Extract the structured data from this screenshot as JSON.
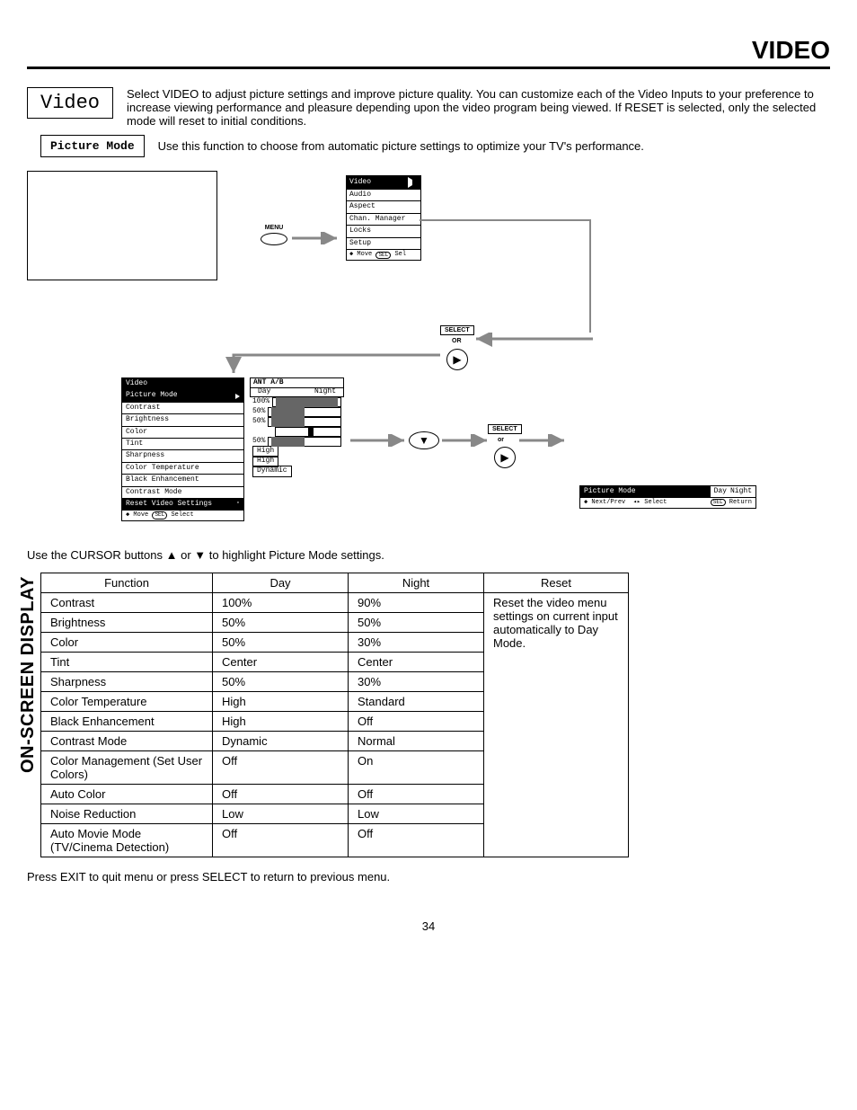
{
  "header": {
    "title": "VIDEO"
  },
  "intro": {
    "box_label": "Video",
    "text": "Select VIDEO to adjust picture settings and improve picture quality.  You can customize each of the Video Inputs to your preference to increase viewing performance and pleasure depending upon the video program being viewed.  If RESET is selected, only the selected mode will reset to initial conditions."
  },
  "sub": {
    "box_label": "Picture Mode",
    "text": "Use this function to choose from automatic picture settings to optimize your TV's performance."
  },
  "diagram": {
    "menu_btn": "MENU",
    "main_menu": [
      "Video",
      "Audio",
      "Aspect",
      "Chan. Manager",
      "Locks",
      "Setup"
    ],
    "main_footer_move": "Move",
    "main_footer_sel": "Sel",
    "select_label": "SELECT",
    "or_label": "OR",
    "or_label2": "or",
    "video_header": "Video",
    "video_items": [
      "Picture Mode",
      "Contrast",
      "Brightness",
      "Color",
      "Tint",
      "Sharpness",
      "Color Temperature",
      "Black Enhancement",
      "Contrast Mode",
      "Reset Video Settings"
    ],
    "video_footer_move": "Move",
    "video_footer_select": "Select",
    "ant_label": "ANT A/B",
    "values": {
      "day": "Day",
      "night": "Night",
      "contrast": "100%",
      "brightness": "50%",
      "color": "50%",
      "sharpness": "50%",
      "colortemp": "High",
      "blackenh": "High",
      "contrastmode": "Dynamic"
    },
    "picmode": {
      "label": "Picture Mode",
      "day": "Day",
      "night": "Night",
      "footer_l": "Next/Prev",
      "footer_m": "Select",
      "footer_r": "Return"
    }
  },
  "instruction": "Use the CURSOR buttons ▲ or ▼ to highlight Picture Mode settings.",
  "table": {
    "headers": [
      "Function",
      "Day",
      "Night",
      "Reset"
    ],
    "rows": [
      [
        "Contrast",
        "100%",
        "90%"
      ],
      [
        "Brightness",
        "50%",
        "50%"
      ],
      [
        "Color",
        "50%",
        "30%"
      ],
      [
        "Tint",
        "Center",
        "Center"
      ],
      [
        "Sharpness",
        "50%",
        "30%"
      ],
      [
        "Color Temperature",
        "High",
        "Standard"
      ],
      [
        "Black Enhancement",
        "High",
        "Off"
      ],
      [
        "Contrast Mode",
        "Dynamic",
        "Normal"
      ],
      [
        "Color Management (Set User Colors)",
        "Off",
        "On"
      ],
      [
        "Auto Color",
        "Off",
        "Off"
      ],
      [
        "Noise Reduction",
        "Low",
        "Low"
      ],
      [
        "Auto Movie Mode (TV/Cinema Detection)",
        "Off",
        "Off"
      ]
    ],
    "reset_text": "Reset the video menu settings on current input automatically to Day Mode."
  },
  "bottom_instruction": "Press EXIT to quit menu or press SELECT to return to previous menu.",
  "side_label": "ON-SCREEN DISPLAY",
  "page_num": "34"
}
